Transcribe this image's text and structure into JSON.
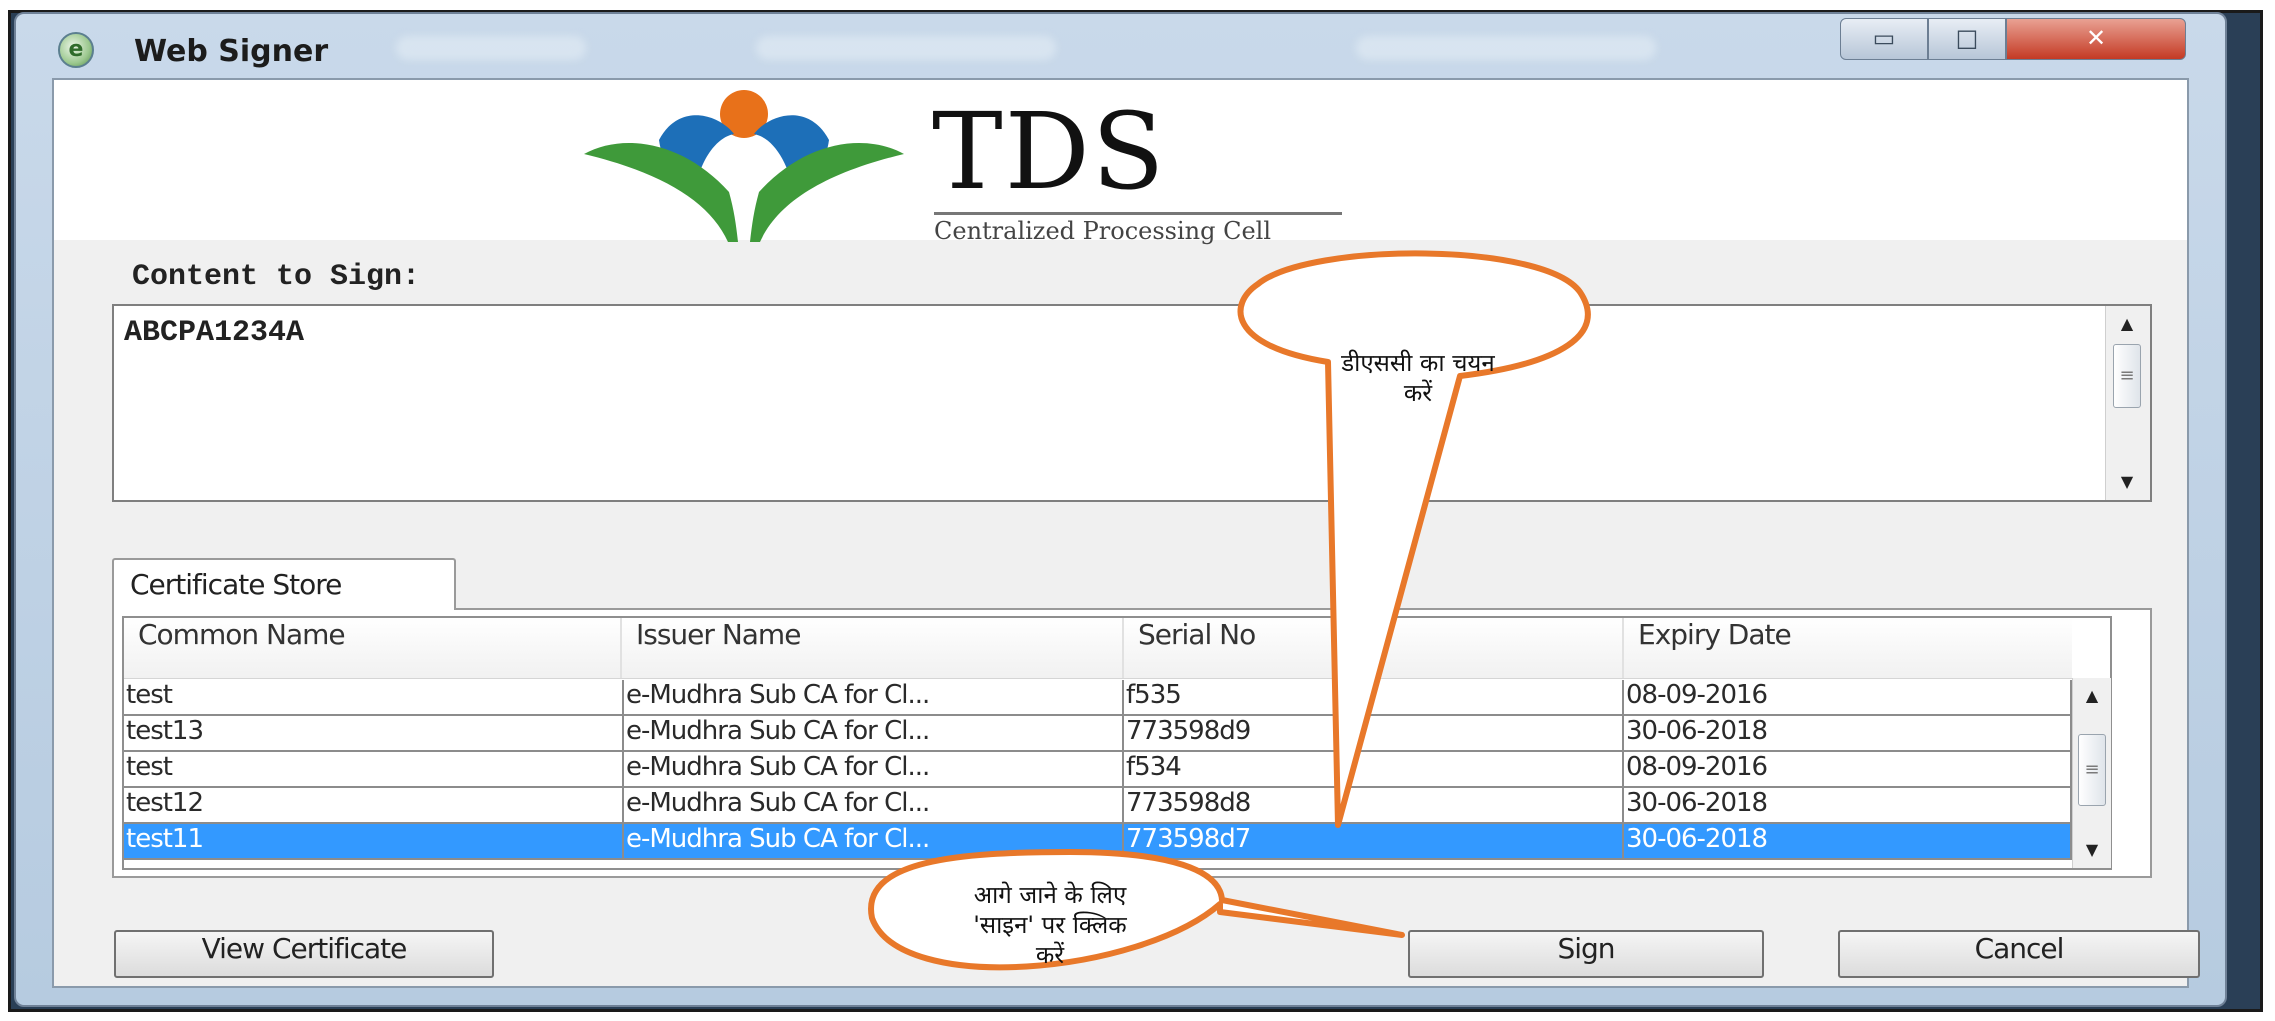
{
  "window": {
    "title": "Web Signer",
    "app_icon_glyph": "e",
    "controls": {
      "minimize": "▭",
      "maximize": "□",
      "close": "✕"
    }
  },
  "banner": {
    "logo_title": "TDS",
    "logo_subtitle": "Centralized Processing Cell",
    "colors": {
      "orange": "#e8711a",
      "blue": "#1d6fb8",
      "green": "#3f9a3a"
    }
  },
  "content": {
    "label": "Content to Sign:",
    "value": "ABCPA1234A"
  },
  "certificate_store": {
    "tab_label": "Certificate Store",
    "columns": [
      "Common Name",
      "Issuer Name",
      "Serial No",
      "Expiry Date"
    ],
    "rows": [
      [
        "test",
        "e-Mudhra Sub CA for Cl...",
        "f535",
        "08-09-2016"
      ],
      [
        "test13",
        "e-Mudhra Sub CA for Cl...",
        "773598d9",
        "30-06-2018"
      ],
      [
        "test",
        "e-Mudhra Sub CA for Cl...",
        "f534",
        "08-09-2016"
      ],
      [
        "test12",
        "e-Mudhra Sub CA for Cl...",
        "773598d8",
        "30-06-2018"
      ],
      [
        "test11",
        "e-Mudhra Sub CA for Cl...",
        "773598d7",
        "30-06-2018"
      ]
    ],
    "selected_row_index": 4,
    "selection_color": "#3399ff"
  },
  "buttons": {
    "view_certificate": "View Certificate",
    "sign": "Sign",
    "cancel": "Cancel"
  },
  "callouts": {
    "select_dsc": [
      "डीएससी का चयन",
      "करें"
    ],
    "click_sign": [
      "आगे जाने के लिए",
      "'साइन' पर क्लिक",
      "करें"
    ],
    "color": "#e8782a"
  },
  "scrollbar": {
    "up": "▲",
    "down": "▼",
    "grip": "≡"
  }
}
